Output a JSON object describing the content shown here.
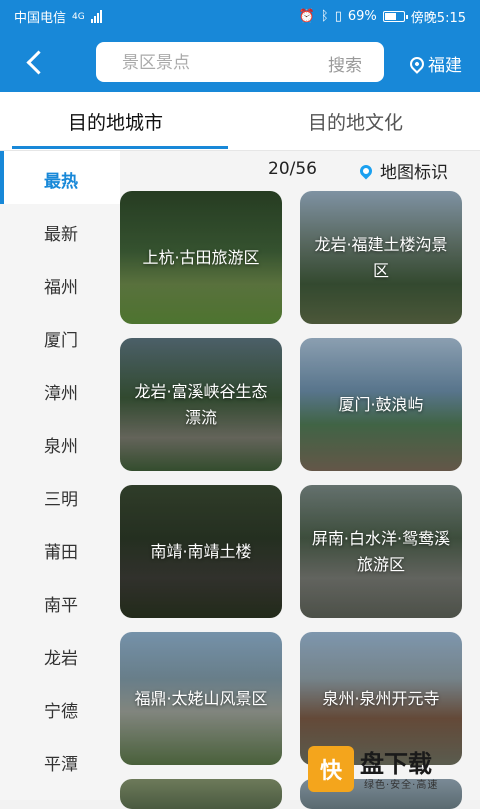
{
  "status_bar": {
    "carrier": "中国电信",
    "network": "4G",
    "battery": "69%",
    "battery_level": 0.69,
    "time": "傍晚5:15",
    "icons": [
      "alarm-icon",
      "bluetooth-icon",
      "vibrate-icon",
      "battery-icon",
      "signal-icon"
    ]
  },
  "header": {
    "search_placeholder": "景区景点",
    "search_button": "搜索",
    "location": "福建",
    "back_icon": "chevron-left-icon",
    "location_icon": "map-pin-icon"
  },
  "tabs": [
    {
      "label": "目的地城市",
      "active": true
    },
    {
      "label": "目的地文化",
      "active": false
    }
  ],
  "sidebar": {
    "items": [
      {
        "label": "最热",
        "active": true
      },
      {
        "label": "最新"
      },
      {
        "label": "福州"
      },
      {
        "label": "厦门"
      },
      {
        "label": "漳州"
      },
      {
        "label": "泉州"
      },
      {
        "label": "三明"
      },
      {
        "label": "莆田"
      },
      {
        "label": "南平"
      },
      {
        "label": "龙岩"
      },
      {
        "label": "宁德"
      },
      {
        "label": "平潭"
      }
    ]
  },
  "content": {
    "count": "20/56",
    "map_label": "地图标识",
    "map_icon": "map-pin-icon",
    "cards": [
      {
        "title": "上杭·古田旅游区"
      },
      {
        "title": "龙岩·福建土楼沟景区"
      },
      {
        "title": "龙岩·富溪峡谷生态漂流"
      },
      {
        "title": "厦门·鼓浪屿"
      },
      {
        "title": "南靖·南靖土楼"
      },
      {
        "title": "屏南·白水洋·鸳鸯溪旅游区"
      },
      {
        "title": "福鼎·太姥山风景区"
      },
      {
        "title": "泉州·泉州开元寺"
      }
    ]
  },
  "watermark": {
    "logo_text": "快",
    "title": "盘下载",
    "subtitle": "绿色·安全·高速"
  },
  "colors": {
    "primary": "#1888d8",
    "sidebar_bg": "#f5f5f5",
    "map_pin": "#1aa0f0"
  }
}
